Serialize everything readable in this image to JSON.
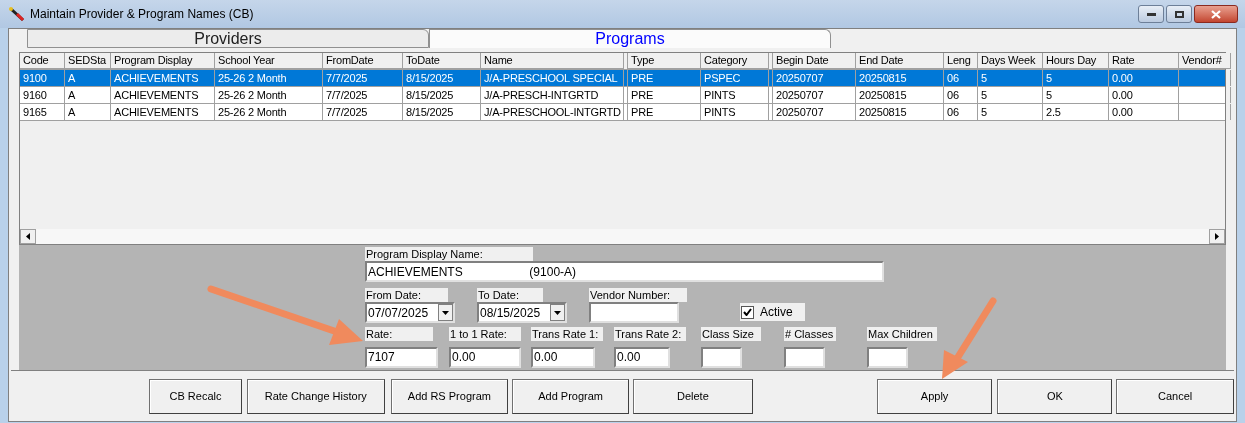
{
  "window": {
    "title": "Maintain Provider & Program Names (CB)"
  },
  "tabs": [
    {
      "label": "Providers",
      "selected": false
    },
    {
      "label": "Programs",
      "selected": true
    }
  ],
  "table": {
    "columns": [
      "Code",
      "SEDSta",
      "Program Display",
      "School Year",
      "FromDate",
      "ToDate",
      "Name",
      "Type",
      "Category",
      "Begin Date",
      "End Date",
      "Leng",
      "Days Week",
      "Hours Day",
      "Rate",
      "Vendor#"
    ],
    "rows": [
      {
        "selected": true,
        "cells": [
          "9100",
          "A",
          "ACHIEVEMENTS",
          "25-26 2 Month",
          "7/7/2025",
          "8/15/2025",
          "J/A-PRESCHOOL SPECIAL",
          "PRE",
          "PSPEC",
          "20250707",
          "20250815",
          "06",
          "5",
          "5",
          "0.00",
          ""
        ]
      },
      {
        "selected": false,
        "cells": [
          "9160",
          "A",
          "ACHIEVEMENTS",
          "25-26 2 Month",
          "7/7/2025",
          "8/15/2025",
          "J/A-PRESCH-INTGRTD",
          "PRE",
          "PINTS",
          "20250707",
          "20250815",
          "06",
          "5",
          "5",
          "0.00",
          ""
        ]
      },
      {
        "selected": false,
        "cells": [
          "9165",
          "A",
          "ACHIEVEMENTS",
          "25-26 2 Month",
          "7/7/2025",
          "8/15/2025",
          "J/A-PRESCHOOL-INTGRTD",
          "PRE",
          "PINTS",
          "20250707",
          "20250815",
          "06",
          "5",
          "2.5",
          "0.00",
          ""
        ]
      }
    ]
  },
  "form": {
    "program_display_name": {
      "label": "Program Display Name:",
      "value": "ACHIEVEMENTS                    (9100-A)"
    },
    "from_date": {
      "label": "From Date:",
      "value": "07/07/2025"
    },
    "to_date": {
      "label": "To Date:",
      "value": "08/15/2025"
    },
    "vendor_number": {
      "label": "Vendor Number:"
    },
    "active": {
      "label": "Active",
      "checked": true
    },
    "rate_fields": [
      {
        "label": "Rate:",
        "value": "7107"
      },
      {
        "label": "1 to 1 Rate:",
        "value": "0.00"
      },
      {
        "label": "Trans Rate 1:",
        "value": "0.00"
      },
      {
        "label": "Trans Rate 2:",
        "value": "0.00"
      },
      {
        "label": "Class Size"
      },
      {
        "label": "# Classes"
      },
      {
        "label": "Max Children"
      }
    ]
  },
  "buttons": [
    "CB Recalc",
    "Rate Change History",
    "Add RS Program",
    "Add Program",
    "Delete",
    "Apply",
    "OK",
    "Cancel"
  ]
}
